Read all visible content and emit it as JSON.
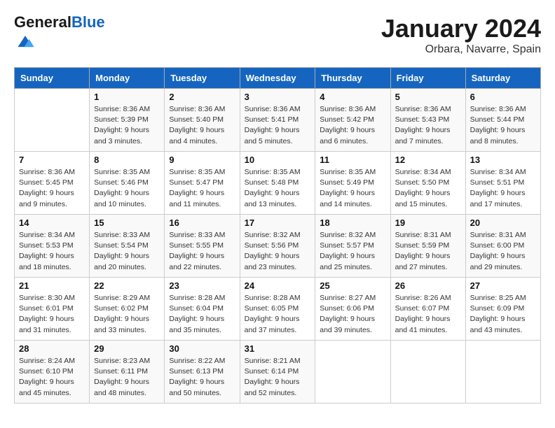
{
  "header": {
    "logo_general": "General",
    "logo_blue": "Blue",
    "month_title": "January 2024",
    "location": "Orbara, Navarre, Spain"
  },
  "weekdays": [
    "Sunday",
    "Monday",
    "Tuesday",
    "Wednesday",
    "Thursday",
    "Friday",
    "Saturday"
  ],
  "weeks": [
    [
      {
        "num": "",
        "sunrise": "",
        "sunset": "",
        "daylight": ""
      },
      {
        "num": "1",
        "sunrise": "Sunrise: 8:36 AM",
        "sunset": "Sunset: 5:39 PM",
        "daylight": "Daylight: 9 hours and 3 minutes."
      },
      {
        "num": "2",
        "sunrise": "Sunrise: 8:36 AM",
        "sunset": "Sunset: 5:40 PM",
        "daylight": "Daylight: 9 hours and 4 minutes."
      },
      {
        "num": "3",
        "sunrise": "Sunrise: 8:36 AM",
        "sunset": "Sunset: 5:41 PM",
        "daylight": "Daylight: 9 hours and 5 minutes."
      },
      {
        "num": "4",
        "sunrise": "Sunrise: 8:36 AM",
        "sunset": "Sunset: 5:42 PM",
        "daylight": "Daylight: 9 hours and 6 minutes."
      },
      {
        "num": "5",
        "sunrise": "Sunrise: 8:36 AM",
        "sunset": "Sunset: 5:43 PM",
        "daylight": "Daylight: 9 hours and 7 minutes."
      },
      {
        "num": "6",
        "sunrise": "Sunrise: 8:36 AM",
        "sunset": "Sunset: 5:44 PM",
        "daylight": "Daylight: 9 hours and 8 minutes."
      }
    ],
    [
      {
        "num": "7",
        "sunrise": "Sunrise: 8:36 AM",
        "sunset": "Sunset: 5:45 PM",
        "daylight": "Daylight: 9 hours and 9 minutes."
      },
      {
        "num": "8",
        "sunrise": "Sunrise: 8:35 AM",
        "sunset": "Sunset: 5:46 PM",
        "daylight": "Daylight: 9 hours and 10 minutes."
      },
      {
        "num": "9",
        "sunrise": "Sunrise: 8:35 AM",
        "sunset": "Sunset: 5:47 PM",
        "daylight": "Daylight: 9 hours and 11 minutes."
      },
      {
        "num": "10",
        "sunrise": "Sunrise: 8:35 AM",
        "sunset": "Sunset: 5:48 PM",
        "daylight": "Daylight: 9 hours and 13 minutes."
      },
      {
        "num": "11",
        "sunrise": "Sunrise: 8:35 AM",
        "sunset": "Sunset: 5:49 PM",
        "daylight": "Daylight: 9 hours and 14 minutes."
      },
      {
        "num": "12",
        "sunrise": "Sunrise: 8:34 AM",
        "sunset": "Sunset: 5:50 PM",
        "daylight": "Daylight: 9 hours and 15 minutes."
      },
      {
        "num": "13",
        "sunrise": "Sunrise: 8:34 AM",
        "sunset": "Sunset: 5:51 PM",
        "daylight": "Daylight: 9 hours and 17 minutes."
      }
    ],
    [
      {
        "num": "14",
        "sunrise": "Sunrise: 8:34 AM",
        "sunset": "Sunset: 5:53 PM",
        "daylight": "Daylight: 9 hours and 18 minutes."
      },
      {
        "num": "15",
        "sunrise": "Sunrise: 8:33 AM",
        "sunset": "Sunset: 5:54 PM",
        "daylight": "Daylight: 9 hours and 20 minutes."
      },
      {
        "num": "16",
        "sunrise": "Sunrise: 8:33 AM",
        "sunset": "Sunset: 5:55 PM",
        "daylight": "Daylight: 9 hours and 22 minutes."
      },
      {
        "num": "17",
        "sunrise": "Sunrise: 8:32 AM",
        "sunset": "Sunset: 5:56 PM",
        "daylight": "Daylight: 9 hours and 23 minutes."
      },
      {
        "num": "18",
        "sunrise": "Sunrise: 8:32 AM",
        "sunset": "Sunset: 5:57 PM",
        "daylight": "Daylight: 9 hours and 25 minutes."
      },
      {
        "num": "19",
        "sunrise": "Sunrise: 8:31 AM",
        "sunset": "Sunset: 5:59 PM",
        "daylight": "Daylight: 9 hours and 27 minutes."
      },
      {
        "num": "20",
        "sunrise": "Sunrise: 8:31 AM",
        "sunset": "Sunset: 6:00 PM",
        "daylight": "Daylight: 9 hours and 29 minutes."
      }
    ],
    [
      {
        "num": "21",
        "sunrise": "Sunrise: 8:30 AM",
        "sunset": "Sunset: 6:01 PM",
        "daylight": "Daylight: 9 hours and 31 minutes."
      },
      {
        "num": "22",
        "sunrise": "Sunrise: 8:29 AM",
        "sunset": "Sunset: 6:02 PM",
        "daylight": "Daylight: 9 hours and 33 minutes."
      },
      {
        "num": "23",
        "sunrise": "Sunrise: 8:28 AM",
        "sunset": "Sunset: 6:04 PM",
        "daylight": "Daylight: 9 hours and 35 minutes."
      },
      {
        "num": "24",
        "sunrise": "Sunrise: 8:28 AM",
        "sunset": "Sunset: 6:05 PM",
        "daylight": "Daylight: 9 hours and 37 minutes."
      },
      {
        "num": "25",
        "sunrise": "Sunrise: 8:27 AM",
        "sunset": "Sunset: 6:06 PM",
        "daylight": "Daylight: 9 hours and 39 minutes."
      },
      {
        "num": "26",
        "sunrise": "Sunrise: 8:26 AM",
        "sunset": "Sunset: 6:07 PM",
        "daylight": "Daylight: 9 hours and 41 minutes."
      },
      {
        "num": "27",
        "sunrise": "Sunrise: 8:25 AM",
        "sunset": "Sunset: 6:09 PM",
        "daylight": "Daylight: 9 hours and 43 minutes."
      }
    ],
    [
      {
        "num": "28",
        "sunrise": "Sunrise: 8:24 AM",
        "sunset": "Sunset: 6:10 PM",
        "daylight": "Daylight: 9 hours and 45 minutes."
      },
      {
        "num": "29",
        "sunrise": "Sunrise: 8:23 AM",
        "sunset": "Sunset: 6:11 PM",
        "daylight": "Daylight: 9 hours and 48 minutes."
      },
      {
        "num": "30",
        "sunrise": "Sunrise: 8:22 AM",
        "sunset": "Sunset: 6:13 PM",
        "daylight": "Daylight: 9 hours and 50 minutes."
      },
      {
        "num": "31",
        "sunrise": "Sunrise: 8:21 AM",
        "sunset": "Sunset: 6:14 PM",
        "daylight": "Daylight: 9 hours and 52 minutes."
      },
      {
        "num": "",
        "sunrise": "",
        "sunset": "",
        "daylight": ""
      },
      {
        "num": "",
        "sunrise": "",
        "sunset": "",
        "daylight": ""
      },
      {
        "num": "",
        "sunrise": "",
        "sunset": "",
        "daylight": ""
      }
    ]
  ]
}
